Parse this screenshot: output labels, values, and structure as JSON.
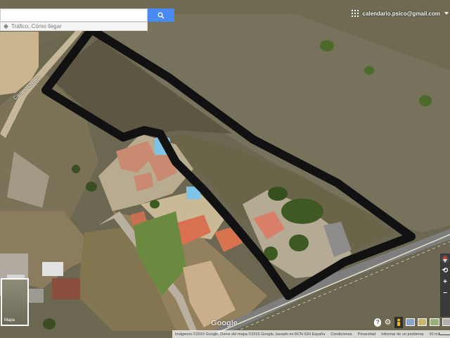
{
  "search": {
    "value": "",
    "placeholder": "",
    "directions_label": "Tráfico, Cómo llegar"
  },
  "account": {
    "email": "calendario.psico@gmail.com"
  },
  "map": {
    "road_label": "Camino Chorro",
    "logo": "Google",
    "minimap_label": "Mapa",
    "boundary_color": "#111111",
    "imagery": "satellite"
  },
  "statusbar": {
    "attribution": "Imágenes ©2015 Google, Datos del mapa ©2015 Google, basado en BCN IGN España",
    "terms": "Condiciones",
    "privacy": "Privacidad",
    "report": "Informar de un problema",
    "scale": "20 m"
  },
  "controls": {
    "zoom_in": "+",
    "zoom_out": "−",
    "help": "?"
  }
}
